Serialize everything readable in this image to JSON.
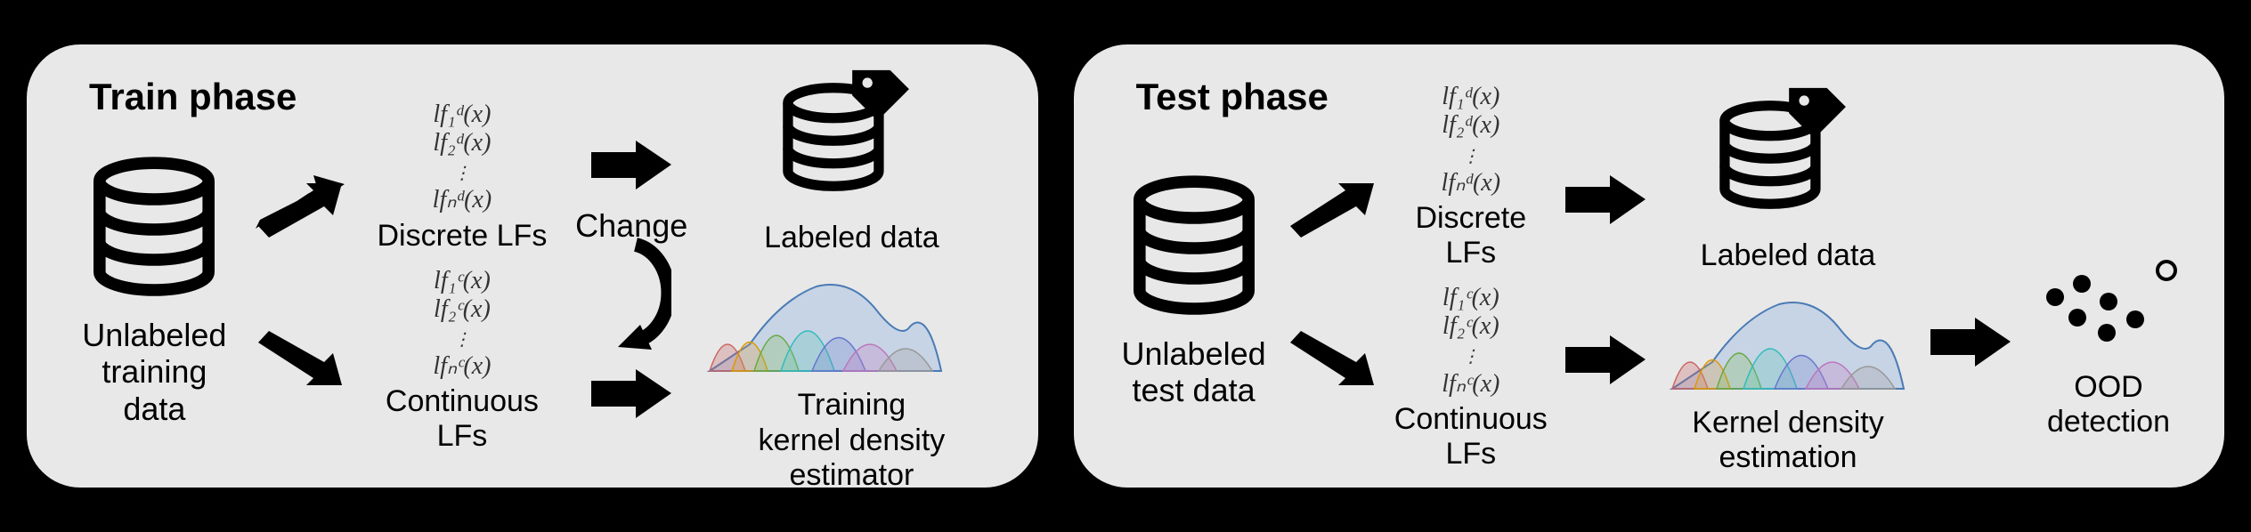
{
  "train": {
    "title": "Train phase",
    "input_label": "Unlabeled\ntraining data",
    "discrete_label": "Discrete LFs",
    "continuous_label": "Continuous LFs",
    "change_label": "Change",
    "labeled_label": "Labeled data",
    "kde_label": "Training\nkernel density estimator",
    "lf_d": [
      "lf₁ᵈ(x)",
      "lf₂ᵈ(x)",
      "⋮",
      "lfₙᵈ(x)"
    ],
    "lf_c": [
      "lf₁ᶜ(x)",
      "lf₂ᶜ(x)",
      "⋮",
      "lfₙᶜ(x)"
    ]
  },
  "test": {
    "title": "Test phase",
    "input_label": "Unlabeled\ntest data",
    "discrete_label": "Discrete LFs",
    "continuous_label": "Continuous LFs",
    "labeled_label": "Labeled data",
    "kde_label": "Kernel density estimation",
    "ood_label": "OOD detection",
    "lf_d": [
      "lf₁ᵈ(x)",
      "lf₂ᵈ(x)",
      "⋮",
      "lfₙᵈ(x)"
    ],
    "lf_c": [
      "lf₁ᶜ(x)",
      "lf₂ᶜ(x)",
      "⋮",
      "lfₙᶜ(x)"
    ]
  },
  "icons": {
    "database": "database-icon",
    "tagged_database": "tagged-database-icon",
    "arrow": "arrow-right-icon",
    "curve_arrow": "curve-arrow-icon",
    "kde": "kde-distribution-icon",
    "ood": "ood-scatter-icon"
  }
}
